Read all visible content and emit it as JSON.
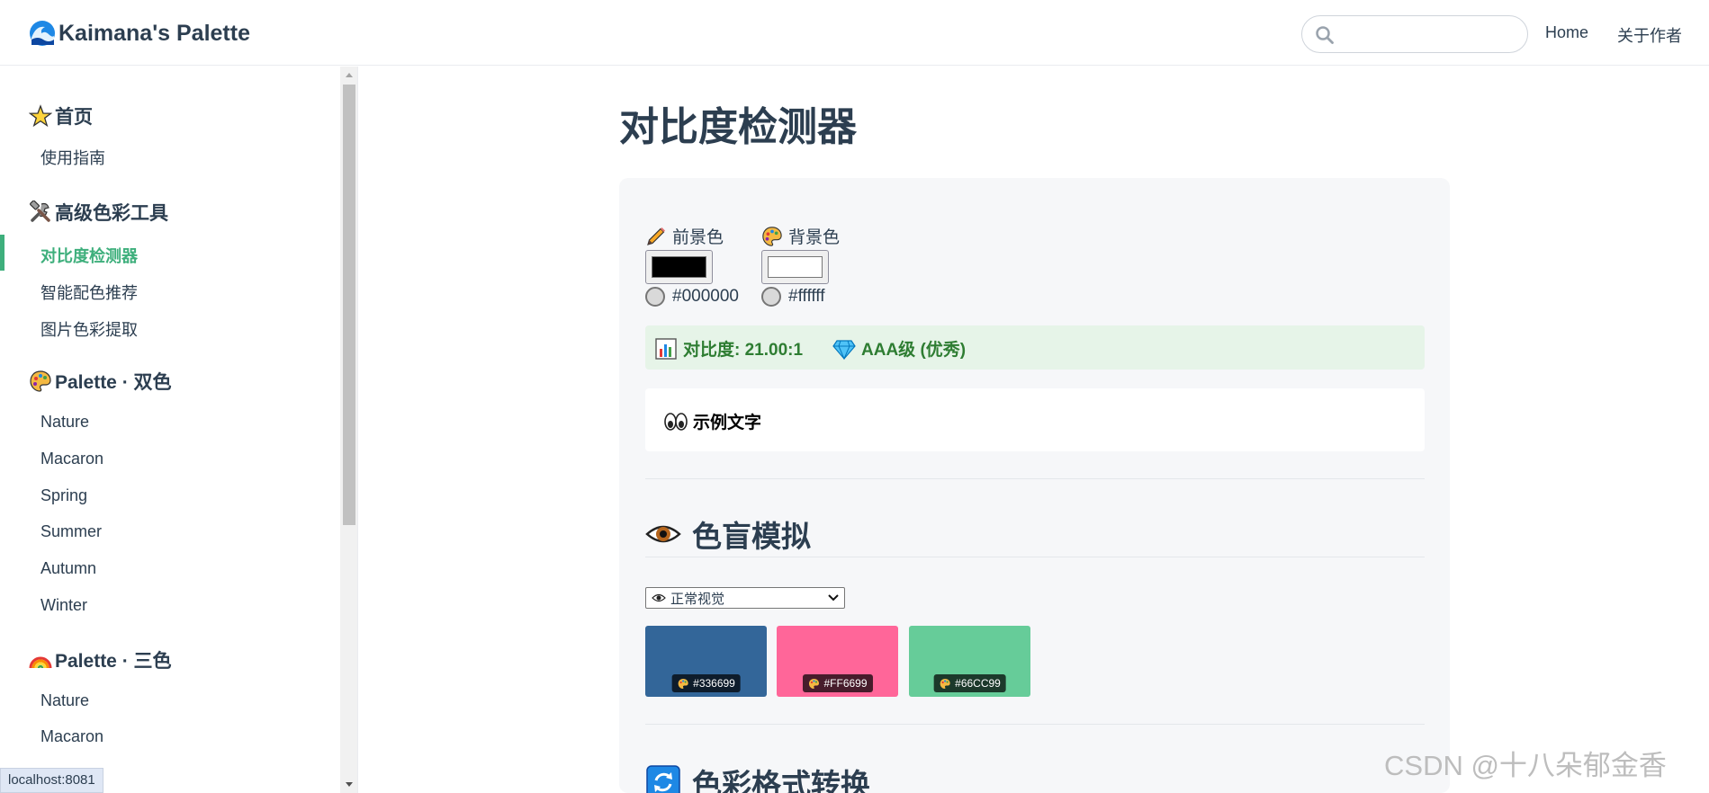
{
  "header": {
    "brand": "Kaimana's Palette",
    "search": {
      "value": "",
      "placeholder": ""
    },
    "nav": [
      "Home",
      "关于作者"
    ]
  },
  "sidebar": {
    "sections": [
      {
        "title": "首页",
        "icon": "star-icon",
        "items": [
          "使用指南"
        ]
      },
      {
        "title": "高级色彩工具",
        "icon": "tools-icon",
        "items": [
          "对比度检测器",
          "智能配色推荐",
          "图片色彩提取"
        ],
        "active": "对比度检测器"
      },
      {
        "title": "Palette · 双色",
        "icon": "palette-icon",
        "items": [
          "Nature",
          "Macaron",
          "Spring",
          "Summer",
          "Autumn",
          "Winter"
        ]
      },
      {
        "title": "Palette · 三色",
        "icon": "rainbow-icon",
        "items": [
          "Nature",
          "Macaron"
        ]
      }
    ]
  },
  "status_bar": {
    "url": "localhost:8081"
  },
  "main": {
    "title": "对比度检测器",
    "foreground": {
      "label": "前景色",
      "value": "#000000",
      "color": "#000000"
    },
    "background": {
      "label": "背景色",
      "value": "#ffffff",
      "color": "#ffffff"
    },
    "result": {
      "contrast": "对比度: 21.00:1",
      "level": "AAA级 (优秀)"
    },
    "sample_text": "示例文字",
    "colorblind": {
      "title": "色盲模拟",
      "select_value": "正常视觉",
      "swatches": [
        {
          "hex": "#336699",
          "color": "#336699"
        },
        {
          "hex": "#FF6699",
          "color": "#FF6699"
        },
        {
          "hex": "#66CC99",
          "color": "#66CC99"
        }
      ]
    },
    "format_convert": {
      "title": "色彩格式转换"
    }
  },
  "watermark": "CSDN @十八朵郁金香",
  "colors": {
    "accent": "#3eaf7c",
    "text": "#2c3e50",
    "success_bg": "#e6f4e8",
    "success_text": "#2e7d32"
  }
}
